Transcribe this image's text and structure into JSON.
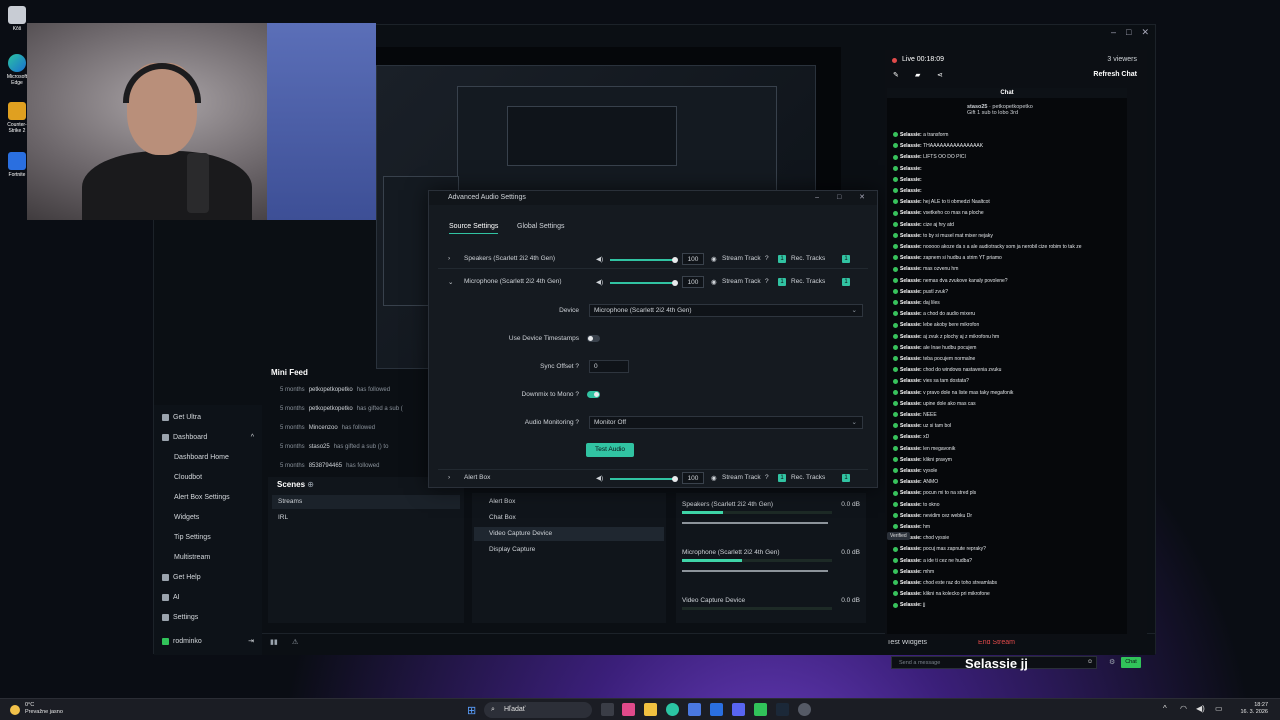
{
  "desktop": {
    "icons": [
      {
        "label": "Kôš"
      },
      {
        "label": "Microsoft Edge"
      },
      {
        "label": "Counter-Strike 2"
      },
      {
        "label": "Fortnite"
      }
    ]
  },
  "sidebar": {
    "items": [
      {
        "label": "Get Ultra",
        "icon": "diamond-icon"
      },
      {
        "label": "Dashboard",
        "icon": "dashboard-icon"
      },
      {
        "label": "Dashboard Home"
      },
      {
        "label": "Cloudbot"
      },
      {
        "label": "Alert Box Settings"
      },
      {
        "label": "Widgets"
      },
      {
        "label": "Tip Settings"
      },
      {
        "label": "Multistream"
      },
      {
        "label": "Get Help",
        "icon": "help-icon"
      },
      {
        "label": "AI",
        "icon": "ai-icon"
      },
      {
        "label": "Settings",
        "icon": "gear-icon"
      }
    ],
    "user": "rodminko"
  },
  "mini_feed": {
    "title": "Mini Feed",
    "rows": [
      {
        "time": "5 months",
        "name": "petkopetkopetko",
        "action": "has followed"
      },
      {
        "time": "5 months",
        "name": "petkopetkopetko",
        "action": "has gifted a sub ("
      },
      {
        "time": "5 months",
        "name": "Mincenzoo",
        "action": "has followed"
      },
      {
        "time": "5 months",
        "name": "stasо25",
        "action": "has gifted a sub () to"
      },
      {
        "time": "5 months",
        "name": "8538794465",
        "action": "has followed"
      }
    ]
  },
  "scenes": {
    "title": "Scenes",
    "items": [
      "Streams",
      "IRL"
    ]
  },
  "sources": {
    "items": [
      "Alert Box",
      "Chat Box",
      "Video Capture Device",
      "Display Capture"
    ]
  },
  "mixer": {
    "channels": [
      {
        "name": "Speakers (Scarlett 2i2 4th Gen)",
        "db": "0.0 dB",
        "level": 0.27
      },
      {
        "name": "Microphone (Scarlett 2i2 4th Gen)",
        "db": "0.0 dB",
        "level": 0.4
      },
      {
        "name": "Video Capture Device",
        "db": "0.0 dB",
        "level": 0
      }
    ]
  },
  "bottom_bar": {
    "test_widgets": "Test Widgets",
    "end_stream": "End Stream"
  },
  "dialog": {
    "title": "Advanced Audio Settings",
    "tabs": [
      "Source Settings",
      "Global Settings"
    ],
    "rows": [
      {
        "name": "Speakers (Scarlett 2i2 4th Gen)",
        "volume": "100",
        "stream": "Stream Track",
        "rec": "Rec. Tracks",
        "track": "1"
      },
      {
        "name": "Microphone (Scarlett 2i2 4th Gen)",
        "volume": "100",
        "stream": "Stream Track",
        "rec": "Rec. Tracks",
        "track": "1"
      },
      {
        "name": "Alert Box",
        "volume": "100",
        "stream": "Stream Track",
        "rec": "Rec. Tracks",
        "track": "1"
      }
    ],
    "form": {
      "device_label": "Device",
      "device_value": "Microphone (Scarlett 2i2 4th Gen)",
      "timestamps_label": "Use Device Timestamps",
      "timestamps_on": false,
      "sync_label": "Sync Offset",
      "sync_value": "0",
      "downmix_label": "Downmix to Mono",
      "downmix_on": true,
      "monitoring_label": "Audio Monitoring",
      "monitoring_value": "Monitor Off",
      "test_audio": "Test Audio"
    }
  },
  "right_panel": {
    "live": "Live 00:18:09",
    "viewers": "3 viewers",
    "refresh": "Refresh Chat",
    "chat_title": "Chat",
    "pinned_user": "stasо25",
    "pinned_target": "petkopetkopetko",
    "pinned_text": "Gift 1 sub to lobo 3rd",
    "messages": [
      "a transform",
      "THAAAAAAAAAAAAAAAK",
      "LIFTS OO DO PICI",
      "",
      "",
      "",
      "hej ALE to ti obmedzi Naaltcot",
      "vsetkeho co mas na ploche",
      "cize aj hry atd",
      "to by si musel mat mixer nejaky",
      "nooooo akoze da s a ale audiotracky som ja nerobil cize robim to tak ze",
      "zapnem si hudbu a strim YT priamo",
      "mas ozvenu hm",
      "nemas dva zvukove kanaly povolene?",
      "pustl zvuk?",
      "daj liles",
      "a chod do audio mixeru",
      "lebe akoby bere mikrofon",
      "aj zvuk z plochy aj z mikrofonu hm",
      "ale Inae hudbu pocujem",
      "teba pocujem normalne",
      "chod do windows nastavenia zvuku",
      "vies sa tam dostata?",
      "v pravo dole na liste mas taky megafonik",
      "upine dole ako mas cas",
      "NEEE",
      "uz si tam bol",
      "xD",
      "len megavonik",
      "klikni pravym",
      "vysole",
      "ANMO",
      "pocun mi to na stred pls",
      "to okno",
      "nevidim cez webku Dr",
      "hm",
      "chod vyssie",
      "pocuj mas zapnute repraky?",
      "a ide ti cez ne hudba?",
      "mhm",
      "chod este raz do toho streamlabs",
      "klikni na kolecko pri mikrofone",
      "jj"
    ],
    "chat_user": "Selassie:",
    "placeholder": "Send a message",
    "send": "Chat",
    "verified": "Verified"
  },
  "overlay": {
    "text": "Selassie  jj"
  },
  "taskbar": {
    "temp": "0°C",
    "weather": "Prevažne jasno",
    "search": "Hľadať",
    "time": "18:27",
    "date": "16. 3. 2026"
  },
  "colors": {
    "accent": "#31c3a2",
    "danger": "#e14a4a",
    "chat_send": "#31c35a"
  }
}
